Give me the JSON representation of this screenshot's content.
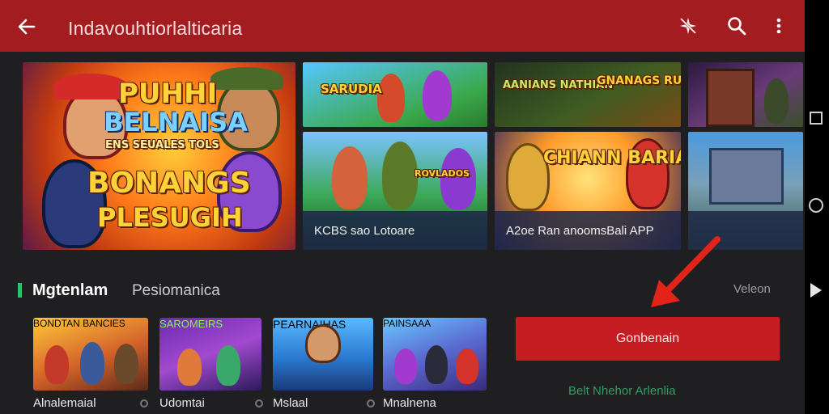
{
  "app": {
    "title": "Indavouhtiorlalticaria"
  },
  "toolbar": {
    "back_icon": "arrow-left-icon",
    "tools": [
      "sparkle-off-icon",
      "search-icon",
      "more-vert-icon"
    ]
  },
  "featured": {
    "hero": {
      "lines": [
        "PUHHI",
        "BELNAISA",
        "ENS SEUALES TOLS",
        "BONANGS",
        "PLESUGIH"
      ]
    },
    "grid": [
      {
        "title": "SARUDIA",
        "caption": ""
      },
      {
        "title": "AANIANS NATHIAN",
        "title2": "GNANAGS RUNKAS",
        "caption": ""
      },
      {
        "title": "",
        "caption": ""
      },
      {
        "title": "ROVLADOS",
        "caption": "KCBS sao Lotoare"
      },
      {
        "title": "CHIANN BARIADAS",
        "caption": "A2oe Ran anoomsBali APP"
      },
      {
        "title": "",
        "caption": ""
      }
    ]
  },
  "section": {
    "title_bold": "Mgtenlam",
    "title_light": "Pesiomanica",
    "view_all": "Veleon"
  },
  "cards": [
    {
      "name": "Alnalemaial",
      "cover_title": "BONDTAN BANCIES"
    },
    {
      "name": "Udomtai",
      "cover_title": "SAROMEIRS"
    },
    {
      "name": "Mslaal",
      "cover_title": "PEARNAIHAS"
    },
    {
      "name": "Mnalnena",
      "cover_title": "PAINSAAA"
    }
  ],
  "actions": {
    "download_label": "Gonbenain",
    "secondary_label": "Belt Nhehor Arlenlia"
  },
  "colors": {
    "top_bar": "#a31d20",
    "background": "#1f1f22",
    "download_button": "#c61d23",
    "accent_green": "#25c46a",
    "pointer_arrow": "#e2231a"
  },
  "system_nav": [
    "recents-square-icon",
    "home-circle-icon",
    "back-triangle-icon"
  ]
}
